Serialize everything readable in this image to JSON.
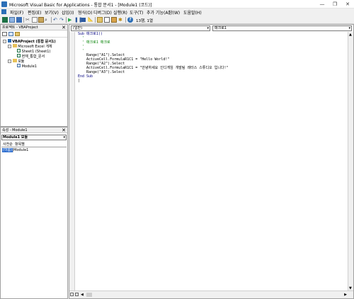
{
  "window": {
    "title": "Microsoft Visual Basic for Applications - 통합 문서1 - [Module1 (코드)]",
    "minimize": "—",
    "restore": "❐",
    "close": "✕"
  },
  "menu": [
    "파일(F)",
    "편집(E)",
    "보기(V)",
    "삽입(I)",
    "형식(O)",
    "디버그(D)",
    "실행(R)",
    "도구(T)",
    "추가 기능(A)",
    "창(W)",
    "도움말(H)"
  ],
  "toolbar": {
    "position": "13행, 1열",
    "icons": [
      "excel-icon",
      "insert-module-icon",
      "save-icon",
      "cut-icon",
      "copy-icon",
      "paste-icon",
      "find-icon",
      "undo-icon",
      "redo-icon",
      "run-icon",
      "break-icon",
      "reset-icon",
      "design-mode-icon",
      "project-explorer-icon",
      "properties-icon",
      "object-browser-icon",
      "toolbox-icon",
      "help-icon"
    ]
  },
  "project": {
    "title": "프로젝트 - VBAProject",
    "root": "VBAProject (통합 문서1)",
    "excel_objects": "Microsoft Excel 개체",
    "sheet1": "Sheet1 (Sheet1)",
    "workbook": "현재_통합_문서",
    "modules": "모듈",
    "module1": "Module1"
  },
  "properties": {
    "title": "속성 - Module1",
    "object": "Module1 모듈",
    "tab_alpha": "사전순",
    "tab_category": "항목별",
    "prop_name": "(이름)",
    "prop_value": "Module1"
  },
  "code": {
    "object_combo": "(일반)",
    "proc_combo": "매크로1",
    "lines": [
      {
        "t": "Sub 매크로1()",
        "c": "kw",
        "i": 0
      },
      {
        "t": "'",
        "c": "cm",
        "i": 1
      },
      {
        "t": "' 매크로1 매크로",
        "c": "cm",
        "i": 1
      },
      {
        "t": "'",
        "c": "cm",
        "i": 1
      },
      {
        "t": "",
        "c": "",
        "i": 0
      },
      {
        "t": "'",
        "c": "cm",
        "i": 1
      },
      {
        "t": "Range(\"A1\").Select",
        "c": "",
        "i": 2
      },
      {
        "t": "ActiveCell.FormulaR1C1 = \"Hello World!\"",
        "c": "",
        "i": 2
      },
      {
        "t": "Range(\"A2\").Select",
        "c": "",
        "i": 2
      },
      {
        "t": "ActiveCell.FormulaR1C1 = \"안녕하세요 인디게임 개발팀 레터스 스튜디오 입니다!\"",
        "c": "",
        "i": 2
      },
      {
        "t": "Range(\"A3\").Select",
        "c": "",
        "i": 2
      },
      {
        "t": "End Sub",
        "c": "kw",
        "i": 0
      },
      {
        "t": "|",
        "c": "",
        "i": 0
      }
    ]
  }
}
